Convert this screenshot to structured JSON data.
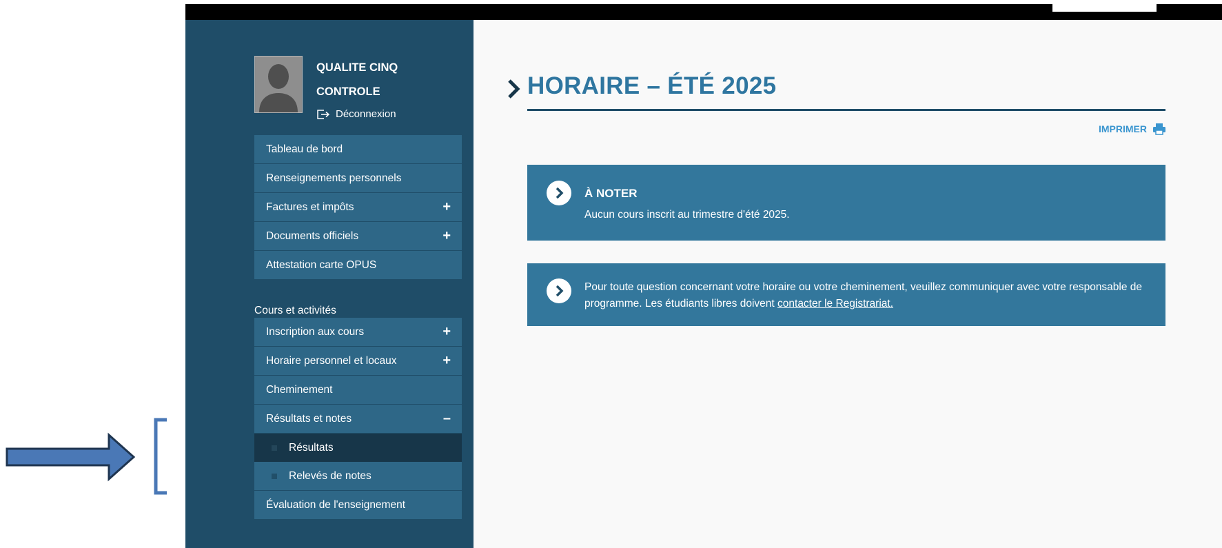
{
  "user": {
    "name_line1": "QUALITE CINQ",
    "name_line2": "CONTROLE",
    "logout_label": "Déconnexion"
  },
  "sidebar": {
    "items": [
      {
        "label": "Tableau de bord"
      },
      {
        "label": "Renseignements personnels"
      },
      {
        "label": "Factures et impôts",
        "toggle": "+"
      },
      {
        "label": "Documents officiels",
        "toggle": "+"
      },
      {
        "label": "Attestation carte OPUS"
      }
    ],
    "section_label": "Cours et activités",
    "course_items": [
      {
        "label": "Inscription aux cours",
        "toggle": "+"
      },
      {
        "label": "Horaire personnel et locaux",
        "toggle": "+"
      },
      {
        "label": "Cheminement"
      },
      {
        "label": "Résultats et notes",
        "toggle": "–",
        "expanded": true
      },
      {
        "label": "Évaluation de l'enseignement"
      }
    ],
    "sub_items": [
      {
        "label": "Résultats",
        "active": true
      },
      {
        "label": "Relevés de notes",
        "active": false
      }
    ]
  },
  "main": {
    "title": "HORAIRE – ÉTÉ 2025",
    "print_label": "IMPRIMER",
    "note": {
      "title": "À NOTER",
      "text": "Aucun cours inscrit au trimestre d'été 2025."
    },
    "info": {
      "text": "Pour toute question concernant votre horaire ou votre cheminement, veuillez communiquer avec votre responsable de programme. Les étudiants libres doivent ",
      "link": "contacter le Registrariat."
    }
  },
  "colors": {
    "sidebar_bg": "#1f4d68",
    "nav_item_bg": "#2e6787",
    "nav_active_bg": "#173649",
    "title_color": "#2f76a0",
    "box_bg": "#33779c",
    "print_color": "#3a95cf",
    "annotation_arrow": "#4a78b6"
  },
  "icons": {
    "avatar": "user-silhouette-icon",
    "logout": "logout-icon",
    "title": "chevron-right-icon",
    "print": "printer-icon",
    "note": "chevron-circle-icon"
  }
}
